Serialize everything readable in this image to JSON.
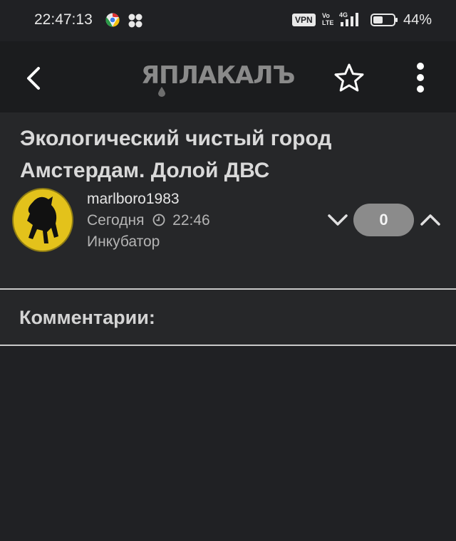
{
  "status_bar": {
    "time": "22:47:13",
    "vpn": "VPN",
    "volte_top": "Vo",
    "volte_bottom": "LTE",
    "network": "4G",
    "battery": "44%"
  },
  "app_bar": {
    "logo": "ЯПЛАКАЛЪ",
    "icons": [
      "back-icon",
      "star-icon",
      "more-vert-icon"
    ]
  },
  "post": {
    "title": "Экологический чистый город Амстердам. Долой ДВС",
    "author": "marlboro1983",
    "date": "Сегодня",
    "time": "22:46",
    "rank": "Инкубатор",
    "votes": "0"
  },
  "comments": {
    "label": "Комментарии:"
  },
  "colors": {
    "background": "#202124",
    "app_bar": "#1b1c1e",
    "vote_pill": "#8b8b8b",
    "avatar_yellow": "#e3c21b"
  }
}
